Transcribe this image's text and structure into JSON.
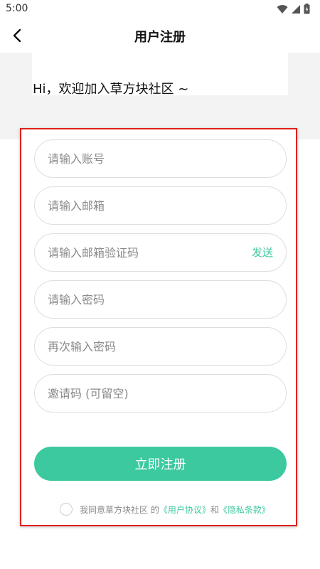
{
  "status_bar": {
    "time": "5:00",
    "icons": [
      "wifi-icon",
      "signal-icon",
      "battery-icon"
    ]
  },
  "header": {
    "title": "用户注册",
    "back_icon": "chevron-left-icon"
  },
  "welcome": {
    "text": "Hi，欢迎加入草方块社区 ~"
  },
  "form": {
    "account_placeholder": "请输入账号",
    "email_placeholder": "请输入邮箱",
    "code_placeholder": "请输入邮箱验证码",
    "send_label": "发送",
    "password_placeholder": "请输入密码",
    "confirm_password_placeholder": "再次输入密码",
    "invite_placeholder": "邀请码 (可留空)",
    "submit_label": "立即注册"
  },
  "agreement": {
    "prefix": "我同意草方块社区 的",
    "user_agreement": "《用户协议》",
    "conjunction": "和",
    "privacy_policy": "《隐私条款》"
  },
  "colors": {
    "accent": "#3cc9a0",
    "highlight_border": "#e0201c",
    "welcome_bg": "#f3f3f3"
  }
}
